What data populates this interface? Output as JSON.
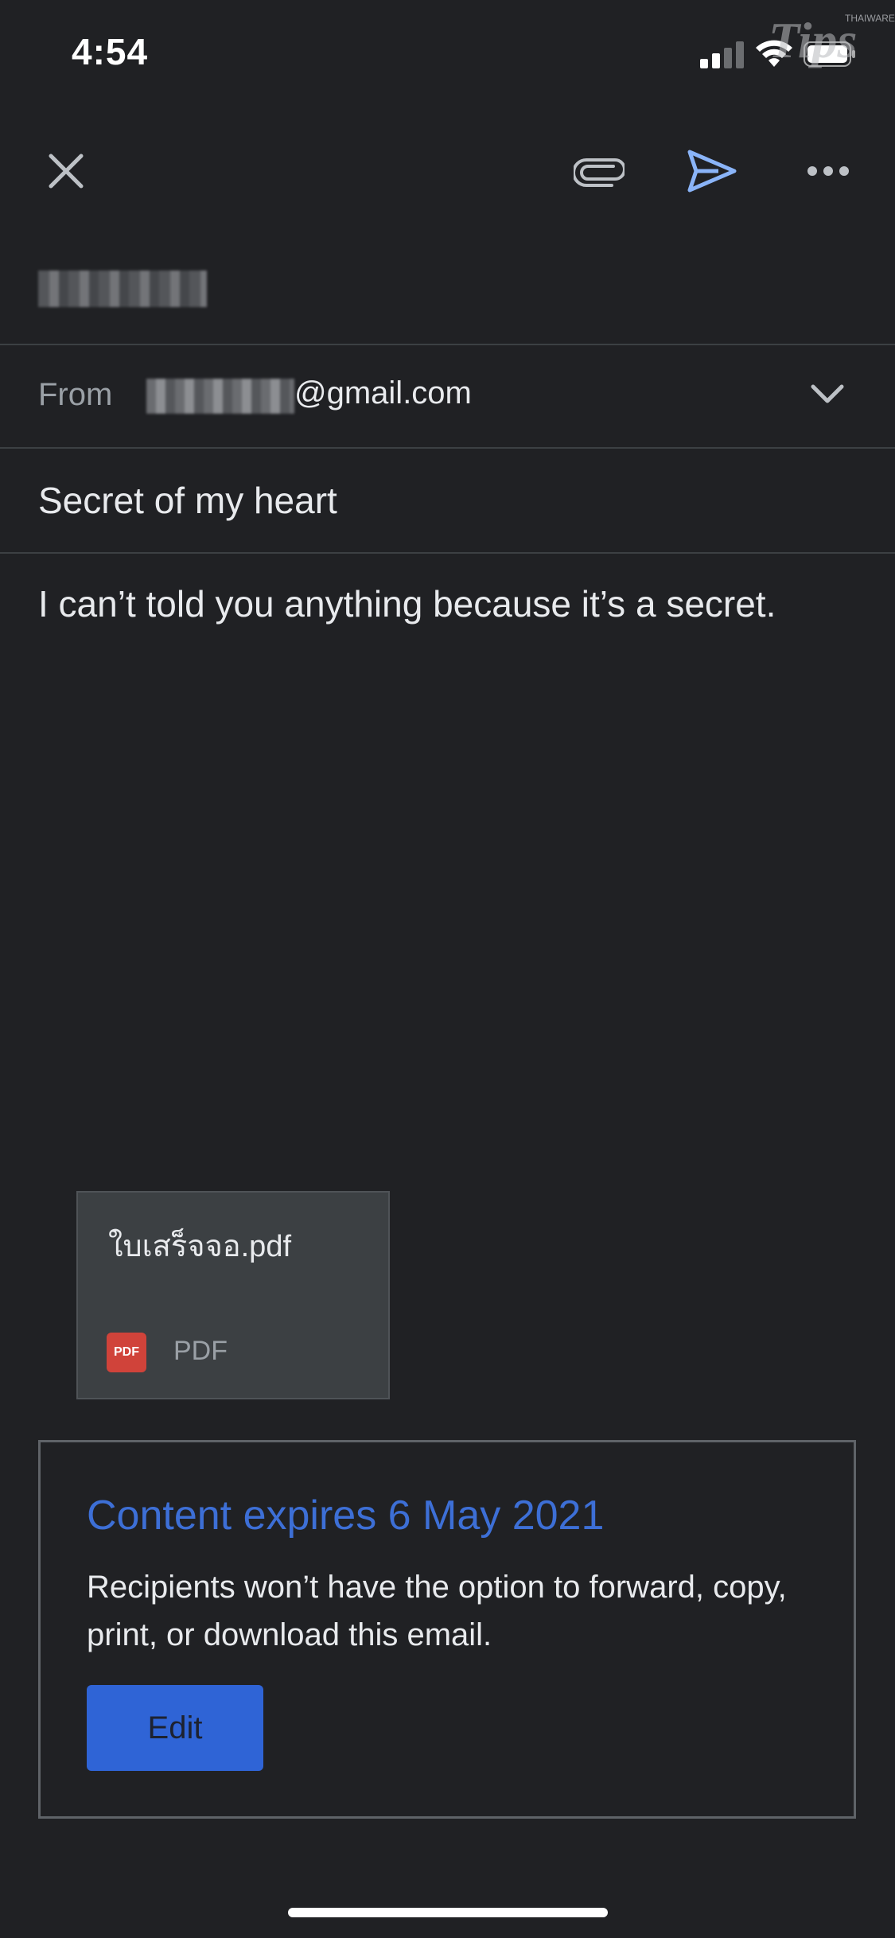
{
  "status_bar": {
    "time": "4:54",
    "signal_icon": "cellular-signal-icon",
    "wifi_icon": "wifi-icon",
    "battery_icon": "battery-icon",
    "watermark": "THAIWARE",
    "watermark_logo": "Tips"
  },
  "toolbar": {
    "close_icon": "close-icon",
    "attach_icon": "paperclip-icon",
    "send_icon": "send-icon",
    "more_icon": "more-horizontal-icon",
    "accent_color": "#8ab4f8"
  },
  "compose": {
    "from_label": "From",
    "from_email_suffix": "@gmail.com",
    "subject": "Secret of my heart",
    "body": "I can’t told you anything because it’s a secret."
  },
  "attachment": {
    "file_name": "ใบเสร็จจอ.pdf",
    "file_type": "PDF",
    "icon_label": "PDF",
    "icon_color": "#d0433a"
  },
  "confidential": {
    "title": "Content expires 6 May 2021",
    "description": "Recipients won’t have the option to forward, copy, print, or download this email.",
    "edit_label": "Edit",
    "title_color": "#3d6fd6",
    "button_color": "#2f64d6"
  }
}
